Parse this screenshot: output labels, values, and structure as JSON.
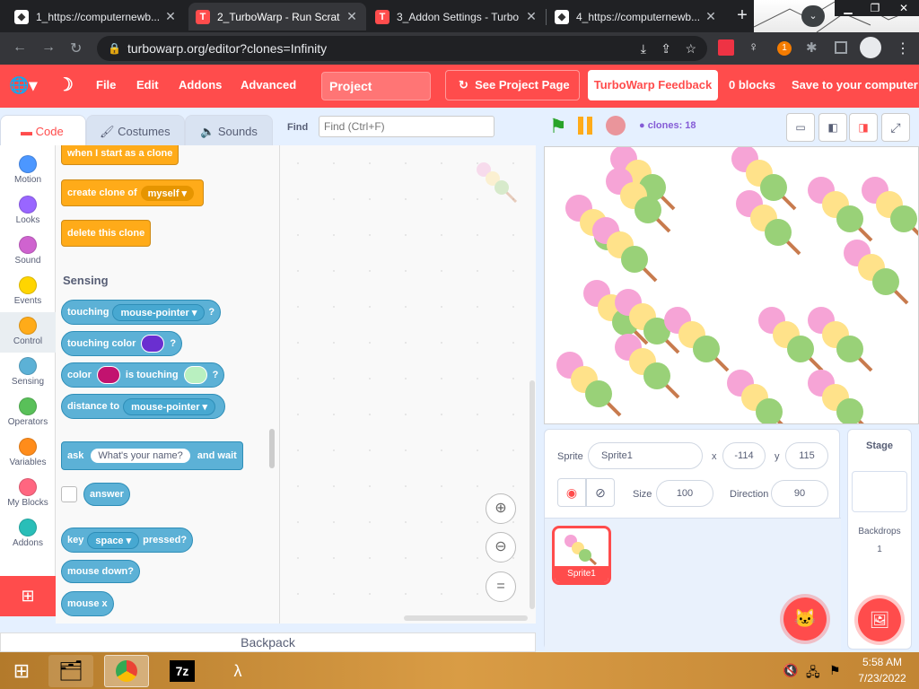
{
  "browser": {
    "tabs": [
      {
        "title": "1_https://computernewb...",
        "active": false
      },
      {
        "title": "2_TurboWarp - Run Scrat",
        "active": true
      },
      {
        "title": "3_Addon Settings - Turbo",
        "active": false
      },
      {
        "title": "4_https://computernewb...",
        "active": false
      }
    ],
    "url": "turbowarp.org/editor?clones=Infinity",
    "extension_badge": "1"
  },
  "menu": {
    "file": "File",
    "edit": "Edit",
    "addons": "Addons",
    "advanced": "Advanced",
    "project_title": "Project",
    "see_project_page": "See Project Page",
    "feedback": "TurboWarp Feedback",
    "blocks_count": "0 blocks",
    "save": "Save to your computer"
  },
  "editor_tabs": {
    "code": "Code",
    "costumes": "Costumes",
    "sounds": "Sounds"
  },
  "find": {
    "label": "Find",
    "placeholder": "Find (Ctrl+F)"
  },
  "categories": [
    {
      "label": "Motion",
      "color": "#4c97ff"
    },
    {
      "label": "Looks",
      "color": "#9966ff"
    },
    {
      "label": "Sound",
      "color": "#cf63cf"
    },
    {
      "label": "Events",
      "color": "#ffd500"
    },
    {
      "label": "Control",
      "color": "#ffab19"
    },
    {
      "label": "Sensing",
      "color": "#5cb1d6"
    },
    {
      "label": "Operators",
      "color": "#59c059"
    },
    {
      "label": "Variables",
      "color": "#ff8c1a"
    },
    {
      "label": "My Blocks",
      "color": "#ff6680"
    },
    {
      "label": "Addons",
      "color": "#29beb8"
    }
  ],
  "blocks": {
    "when_clone": "when I start as a clone",
    "create_clone": "create clone of",
    "myself": "myself",
    "delete_clone": "delete this clone",
    "sensing_header": "Sensing",
    "touching": "touching",
    "mouse_pointer": "mouse-pointer",
    "q": "?",
    "touching_color": "touching color",
    "color": "color",
    "is_touching": "is touching",
    "distance_to": "distance to",
    "ask": "ask",
    "whats_name": "What's your name?",
    "and_wait": "and wait",
    "answer": "answer",
    "key": "key",
    "space": "space",
    "pressed": "pressed?",
    "mouse_down": "mouse down?",
    "mouse_x": "mouse x"
  },
  "stage_controls": {
    "clones": "clones: 18"
  },
  "sprite_info": {
    "sprite_label": "Sprite",
    "sprite_name": "Sprite1",
    "x_label": "x",
    "x": "-114",
    "y_label": "y",
    "y": "115",
    "size_label": "Size",
    "size": "100",
    "direction_label": "Direction",
    "direction": "90",
    "thumb_name": "Sprite1"
  },
  "stage_panel": {
    "title": "Stage",
    "backdrops_label": "Backdrops",
    "backdrops_count": "1"
  },
  "backpack": "Backpack",
  "taskbar": {
    "time": "5:58 AM",
    "date": "7/23/2022"
  }
}
